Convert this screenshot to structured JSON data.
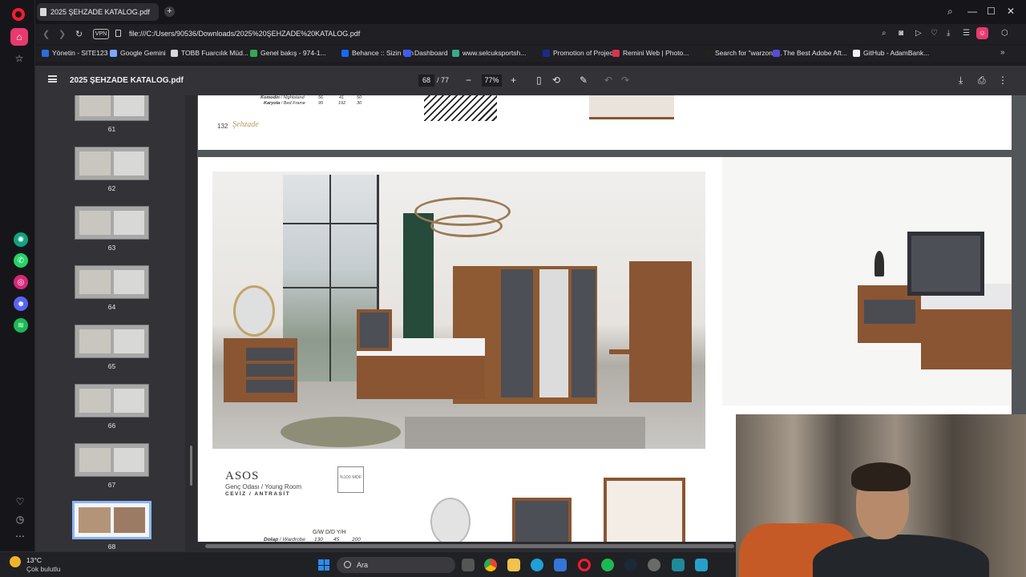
{
  "browser": {
    "tab_title": "2025 ŞEHZADE KATALOG.pdf",
    "new_tab": "+",
    "url": "file:///C:/Users/90536/Downloads/2025%20ŞEHZADE%20KATALOG.pdf",
    "vpn": "VPN",
    "window_controls": {
      "search": "⌕",
      "minimize": "—",
      "maximize": "☐",
      "close": "✕"
    }
  },
  "bookmarks": [
    {
      "label": "Yönetin - SITE123",
      "color": "#2d6cdf"
    },
    {
      "label": "Google Gemini",
      "color": "#7aa7ff"
    },
    {
      "label": "TOBB Fuarcılık Müd...",
      "color": "#d8d8d8"
    },
    {
      "label": "Genel bakış - 974-1...",
      "color": "#34a853"
    },
    {
      "label": "Behance :: Sizin İçin",
      "color": "#1769ff"
    },
    {
      "label": "Dashboard",
      "color": "#3b5cff"
    },
    {
      "label": "www.selcuksportsh...",
      "color": "#3aa88a"
    },
    {
      "label": "Promotion of Projec...",
      "color": "#1b2a8a"
    },
    {
      "label": "Remini Web | Photo...",
      "color": "#e1304c"
    },
    {
      "label": "Search for \"warzone...",
      "color": "#222222"
    },
    {
      "label": "The Best Adobe Aft...",
      "color": "#5b49d6"
    },
    {
      "label": "GitHub - AdamBank...",
      "color": "#f0f0f0"
    }
  ],
  "bookmarks_more": "»",
  "pdf": {
    "title": "2025 ŞEHZADE KATALOG.pdf",
    "current_page": "68",
    "total_pages": "/ 77",
    "zoom": "77%"
  },
  "thumbnails": [
    {
      "label": "61"
    },
    {
      "label": "62"
    },
    {
      "label": "63"
    },
    {
      "label": "64"
    },
    {
      "label": "65"
    },
    {
      "label": "66"
    },
    {
      "label": "67"
    },
    {
      "label": "68",
      "selected": true
    }
  ],
  "page_prev": {
    "rows": [
      {
        "name": "Komodin",
        "en": "Nightstand",
        "w": "56",
        "d": "41",
        "h": "50"
      },
      {
        "name": "Karyola",
        "en": "Bed Frame",
        "w": "95",
        "d": "192",
        "h": "30"
      }
    ],
    "page_number": "132",
    "brand": "Şehzade"
  },
  "page_current": {
    "collection": "ASOS",
    "subtitle": "Genç Odası / Young Room",
    "finish": "CEVİZ / ANTRASİT",
    "badge": "%100 MDF",
    "dim_header": "G/W   D/D   Y/H",
    "dim_row": {
      "name": "Dolap",
      "en": "Wardrobe",
      "w": "130",
      "d": "45",
      "h": "200"
    }
  },
  "taskbar": {
    "temperature": "13°C",
    "weather": "Çok bulutlu",
    "search_placeholder": "Ara"
  }
}
